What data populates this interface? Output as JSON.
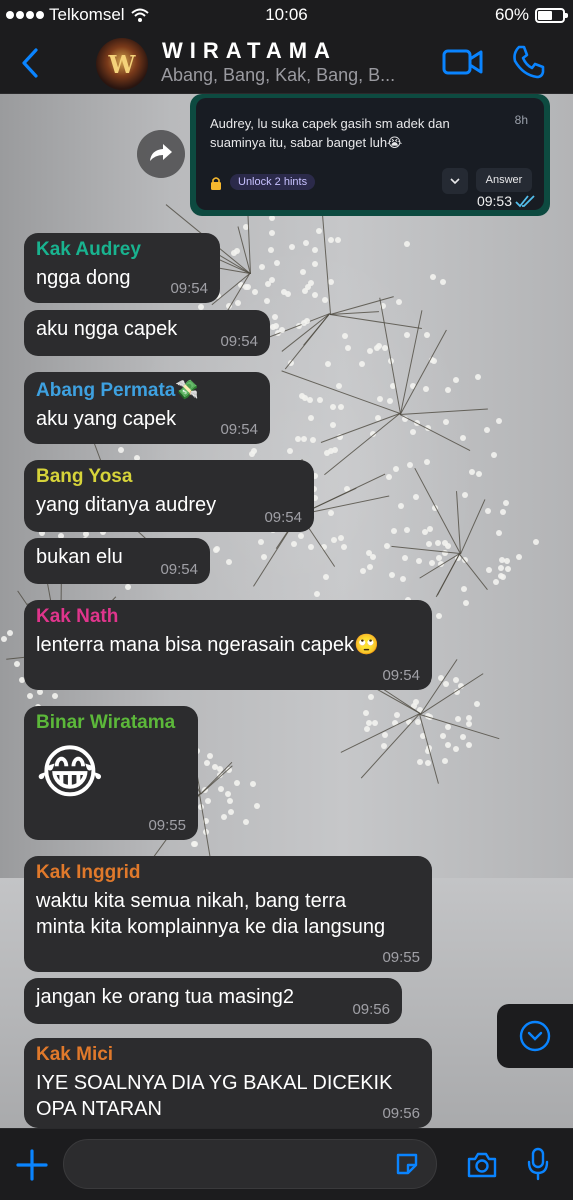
{
  "status_bar": {
    "carrier": "Telkomsel",
    "time": "10:06",
    "battery": "60%",
    "battery_level": 0.6
  },
  "header": {
    "title": "WIRATAMA",
    "subtitle": "Abang, Bang, Kak, Bang, B..."
  },
  "forwarded_card": {
    "question": "Audrey, lu suka capek gasih sm adek dan suaminya itu, sabar banget luh😭",
    "age": "8h",
    "hints_label": "Unlock 2 hints",
    "answer_label": "Answer",
    "time": "09:53"
  },
  "messages": [
    {
      "sender": "Kak Audrey",
      "sender_color": "#19b38f",
      "text": "ngga dong",
      "time": "09:54"
    },
    {
      "sender": "",
      "text": "aku ngga capek",
      "time": "09:54"
    },
    {
      "sender": "Abang Permata💸",
      "sender_color": "#3ea1e0",
      "text": "aku yang capek",
      "time": "09:54"
    },
    {
      "sender": "Bang Yosa",
      "sender_color": "#d6d33a",
      "text": "yang ditanya audrey",
      "time": "09:54"
    },
    {
      "sender": "",
      "text": "bukan elu",
      "time": "09:54"
    },
    {
      "sender": "Kak Nath",
      "sender_color": "#e0358c",
      "text": "lenterra mana bisa ngerasain capek🙄",
      "time": "09:54"
    },
    {
      "sender": "Binar Wiratama",
      "sender_color": "#5cb83a",
      "text": "😂",
      "time": "09:55"
    },
    {
      "sender": "Kak Inggrid",
      "sender_color": "#e0792b",
      "text": "waktu kita semua nikah, bang terra minta kita komplainnya ke dia langsung",
      "time": "09:55"
    },
    {
      "sender": "",
      "text": "jangan ke orang tua masing2",
      "time": "09:56"
    },
    {
      "sender": "Kak Mici",
      "sender_color": "#e0792b",
      "text": "IYE SOALNYA DIA YG BAKAL DICEKIK OPA NTARAN",
      "time": "09:56"
    }
  ],
  "input": {
    "placeholder": ""
  },
  "icons": {
    "back": "chevron-left-icon",
    "video": "video-camera-icon",
    "call": "phone-icon",
    "forward": "forward-arrow-icon",
    "scroll_down": "chevron-down-circle-icon",
    "plus": "plus-icon",
    "sticker": "sticker-icon",
    "camera": "camera-icon",
    "mic": "microphone-icon"
  },
  "colors": {
    "accent": "#0a84ff",
    "bubble": "#2c2c2e",
    "outgoing": "#0d4a40"
  }
}
